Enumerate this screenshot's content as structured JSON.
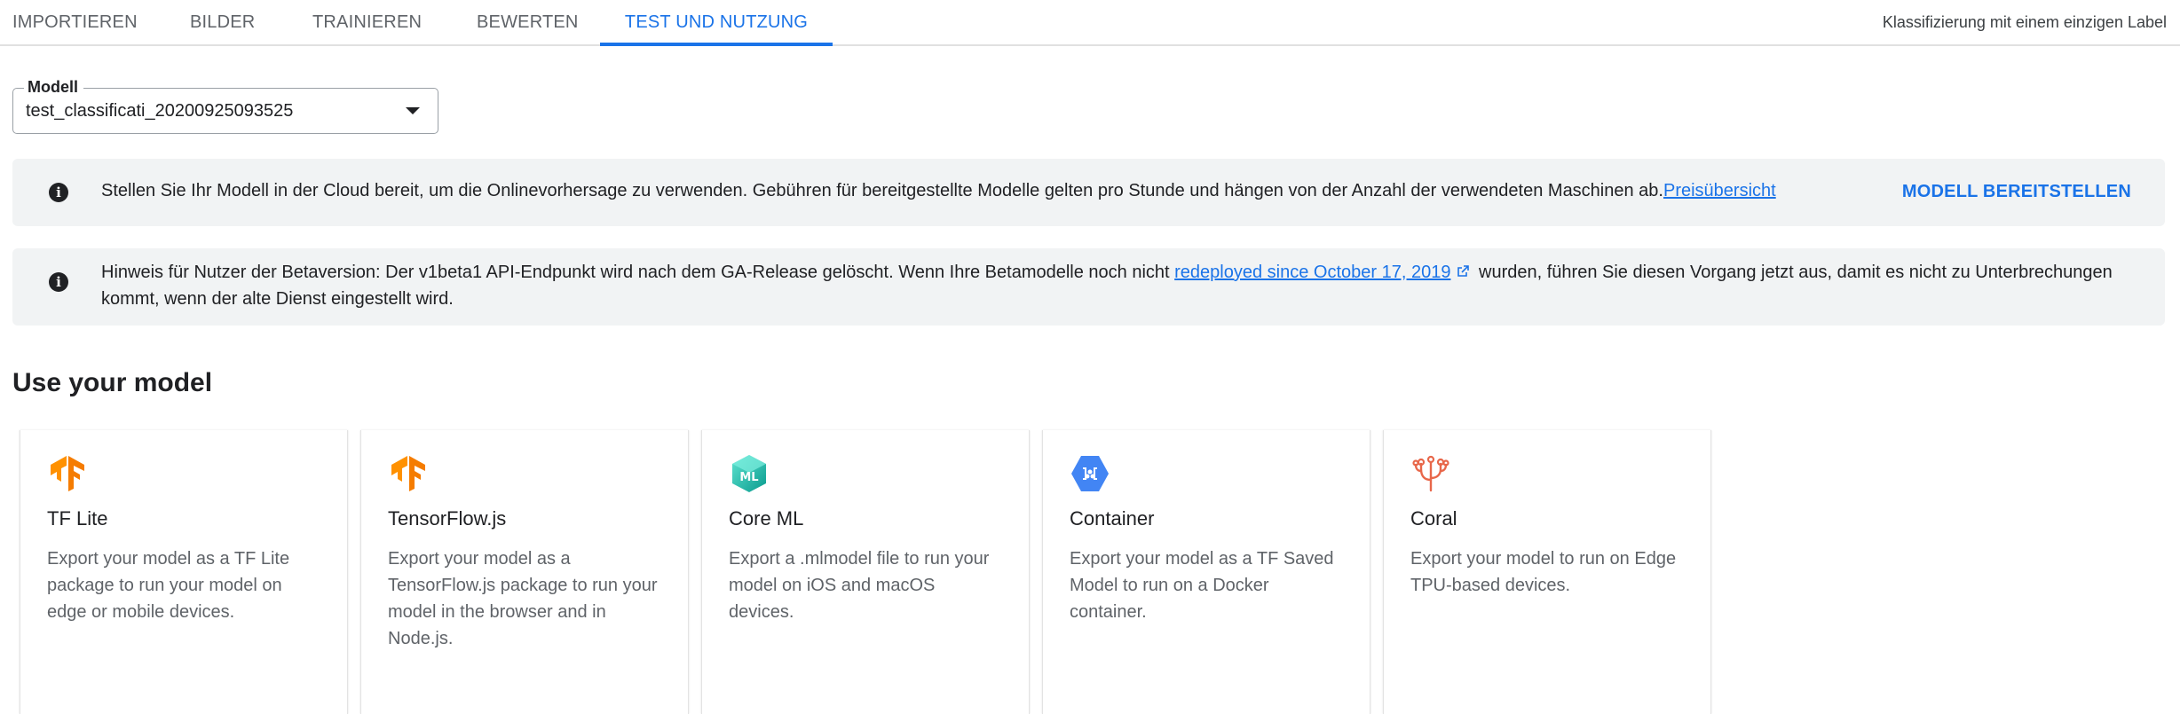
{
  "tabs": [
    {
      "label": "IMPORTIEREN",
      "active": false
    },
    {
      "label": "BILDER",
      "active": false
    },
    {
      "label": "TRAINIEREN",
      "active": false
    },
    {
      "label": "BEWERTEN",
      "active": false
    },
    {
      "label": "TEST UND NUTZUNG",
      "active": true
    }
  ],
  "header": {
    "classification_type": "Klassifizierung mit einem einzigen Label"
  },
  "model_select": {
    "label": "Modell",
    "value": "test_classificati_20200925093525"
  },
  "banners": {
    "deploy": {
      "text": "Stellen Sie Ihr Modell in der Cloud bereit, um die Onlinevorhersage zu verwenden. Gebühren für bereitgestellte Modelle gelten pro Stunde und hängen von der Anzahl der verwendeten Maschinen ab.",
      "link": "Preisübersicht",
      "button": "MODELL BEREITSTELLEN"
    },
    "beta": {
      "text_before": "Hinweis für Nutzer der Betaversion: Der v1beta1 API-Endpunkt wird nach dem GA-Release gelöscht. Wenn Ihre Betamodelle noch nicht ",
      "link": "redeployed since October 17, 2019",
      "text_after": " wurden, führen Sie diesen Vorgang jetzt aus, damit es nicht zu Unterbrechungen kommt, wenn der alte Dienst eingestellt wird."
    }
  },
  "section": {
    "title": "Use your model"
  },
  "cards": [
    {
      "icon": "tensorflow-icon",
      "title": "TF Lite",
      "description": "Export your model as a TF Lite package to run your model on edge or mobile devices."
    },
    {
      "icon": "tensorflow-icon",
      "title": "TensorFlow.js",
      "description": "Export your model as a TensorFlow.js package to run your model in the browser and in Node.js."
    },
    {
      "icon": "coreml-icon",
      "title": "Core ML",
      "description": "Export a .mlmodel file to run your model on iOS and macOS devices."
    },
    {
      "icon": "container-icon",
      "title": "Container",
      "description": "Export your model as a TF Saved Model to run on a Docker container."
    },
    {
      "icon": "coral-icon",
      "title": "Coral",
      "description": "Export your model to run on Edge TPU-based devices."
    }
  ],
  "colors": {
    "accent": "#1a73e8",
    "tensorflow_orange": "#f57c00",
    "coral": "#e8674a",
    "banner_bg": "#f1f3f4"
  }
}
